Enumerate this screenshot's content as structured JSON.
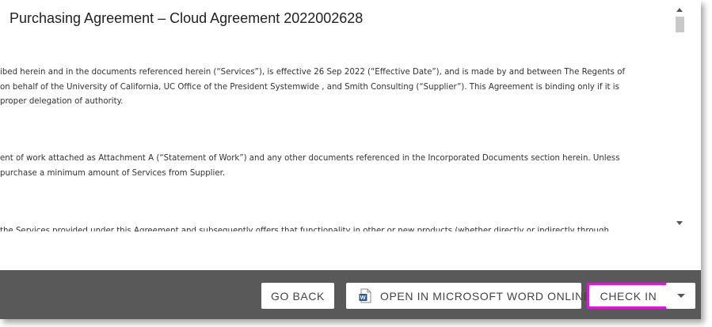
{
  "document": {
    "title": "Purchasing Agreement – Cloud Agreement 2022002628",
    "paragraphs": [
      [
        "ibed herein and in the documents referenced herein (“Services”), is effective 26 Sep 2022  (“Effective Date”), and is made by and between The Regents of",
        "on behalf of the University of California, UC Office of the President Systemwide , and Smith Consulting  (“Supplier”).  This Agreement is binding only if it is",
        " proper delegation of authority."
      ],
      [
        "ent of work attached as Attachment A (“Statement of Work”) and any other documents referenced in the Incorporated Documents section herein.  Unless",
        "purchase a minimum amount of Services from Supplier."
      ],
      [
        "the Services provided under this Agreement and subsequently offers that functionality in other or new products (whether directly or indirectly through"
      ]
    ]
  },
  "footer": {
    "go_back_label": "GO BACK",
    "open_word_label": "OPEN IN MICROSOFT WORD ONLINE",
    "check_in_label": "CHECK IN"
  },
  "icons": {
    "word": "word-doc-icon",
    "dropdown": "chevron-down-icon"
  },
  "colors": {
    "footer_bg": "#595959",
    "highlight": "#ff00ff",
    "word_blue": "#2b579a"
  }
}
